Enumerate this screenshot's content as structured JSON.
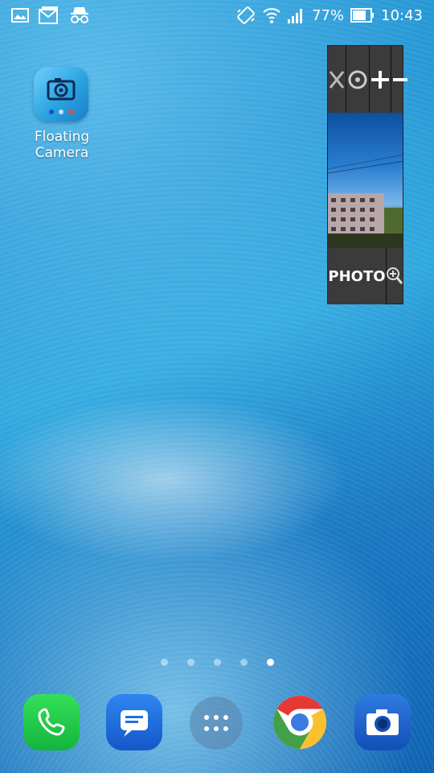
{
  "status_bar": {
    "left_icons": [
      "gallery-icon",
      "gmail-icon",
      "incognito-icon"
    ],
    "right_icons": [
      "vibrate-icon",
      "wifi-icon",
      "signal-icon",
      "battery-icon"
    ],
    "battery_percent": "77%",
    "time": "10:43"
  },
  "home": {
    "apps": [
      {
        "label": "Floating\nCamera",
        "icon": "floating-camera-icon"
      }
    ],
    "page_count": 5,
    "active_page": 4
  },
  "floating_window": {
    "buttons": [
      "close-icon",
      "switch-camera-icon",
      "zoom-plus-icon",
      "zoom-minus-icon"
    ],
    "photo_label": "PHOTO",
    "zoom_icon": "magnifier-icon"
  },
  "dock": {
    "apps": [
      "phone-icon",
      "messages-icon",
      "app-drawer-icon",
      "chrome-icon",
      "camera-icon"
    ]
  },
  "colors": {
    "wallpaper": "#1b8fd0",
    "floating_window": "#3b3b3b",
    "phone": "#22c64a",
    "messages": "#1f6fe0",
    "camera": "#1c5fc8"
  }
}
